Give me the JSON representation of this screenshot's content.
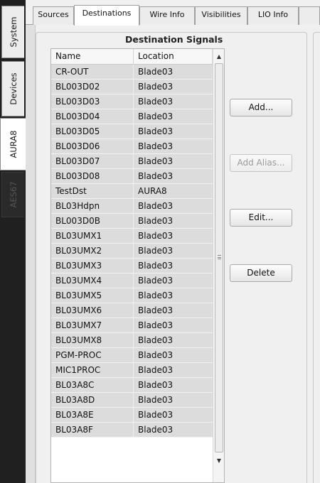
{
  "side_tabs": [
    {
      "label": "System",
      "state": "normal"
    },
    {
      "label": "Devices",
      "state": "normal"
    },
    {
      "label": "AURA8",
      "state": "active"
    },
    {
      "label": "AES67",
      "state": "disabled"
    }
  ],
  "top_tabs": [
    {
      "label": "Sources",
      "state": "normal"
    },
    {
      "label": "Destinations",
      "state": "active"
    },
    {
      "label": "Wire Info",
      "state": "normal"
    },
    {
      "label": "Visibilities",
      "state": "normal"
    },
    {
      "label": "LIO Info",
      "state": "normal"
    }
  ],
  "group": {
    "title": "Destination Signals"
  },
  "table": {
    "columns": [
      "Name",
      "Location"
    ],
    "rows": [
      [
        "CR-OUT",
        "Blade03"
      ],
      [
        "BL003D02",
        "Blade03"
      ],
      [
        "BL003D03",
        "Blade03"
      ],
      [
        "BL003D04",
        "Blade03"
      ],
      [
        "BL003D05",
        "Blade03"
      ],
      [
        "BL003D06",
        "Blade03"
      ],
      [
        "BL003D07",
        "Blade03"
      ],
      [
        "BL003D08",
        "Blade03"
      ],
      [
        "TestDst",
        "AURA8"
      ],
      [
        "BL03Hdpn",
        "Blade03"
      ],
      [
        "BL003D0B",
        "Blade03"
      ],
      [
        "BL03UMX1",
        "Blade03"
      ],
      [
        "BL03UMX2",
        "Blade03"
      ],
      [
        "BL03UMX3",
        "Blade03"
      ],
      [
        "BL03UMX4",
        "Blade03"
      ],
      [
        "BL03UMX5",
        "Blade03"
      ],
      [
        "BL03UMX6",
        "Blade03"
      ],
      [
        "BL03UMX7",
        "Blade03"
      ],
      [
        "BL03UMX8",
        "Blade03"
      ],
      [
        "PGM-PROC",
        "Blade03"
      ],
      [
        "MIC1PROC",
        "Blade03"
      ],
      [
        "BL03A8C",
        "Blade03"
      ],
      [
        "BL03A8D",
        "Blade03"
      ],
      [
        "BL03A8E",
        "Blade03"
      ],
      [
        "BL03A8F",
        "Blade03"
      ]
    ]
  },
  "buttons": {
    "add": {
      "label": "Add...",
      "enabled": true
    },
    "add_alias": {
      "label": "Add Alias...",
      "enabled": false
    },
    "edit": {
      "label": "Edit...",
      "enabled": true
    },
    "delete": {
      "label": "Delete",
      "enabled": true
    }
  },
  "icons": {
    "scroll_up": "scroll-up-arrow-icon",
    "scroll_down": "scroll-down-arrow-icon",
    "scroll_grip": "scroll-grip-icon"
  },
  "colors": {
    "row_background": "#dcdcdc",
    "window_background": "#f0f0f0",
    "side_strip": "#202020"
  }
}
